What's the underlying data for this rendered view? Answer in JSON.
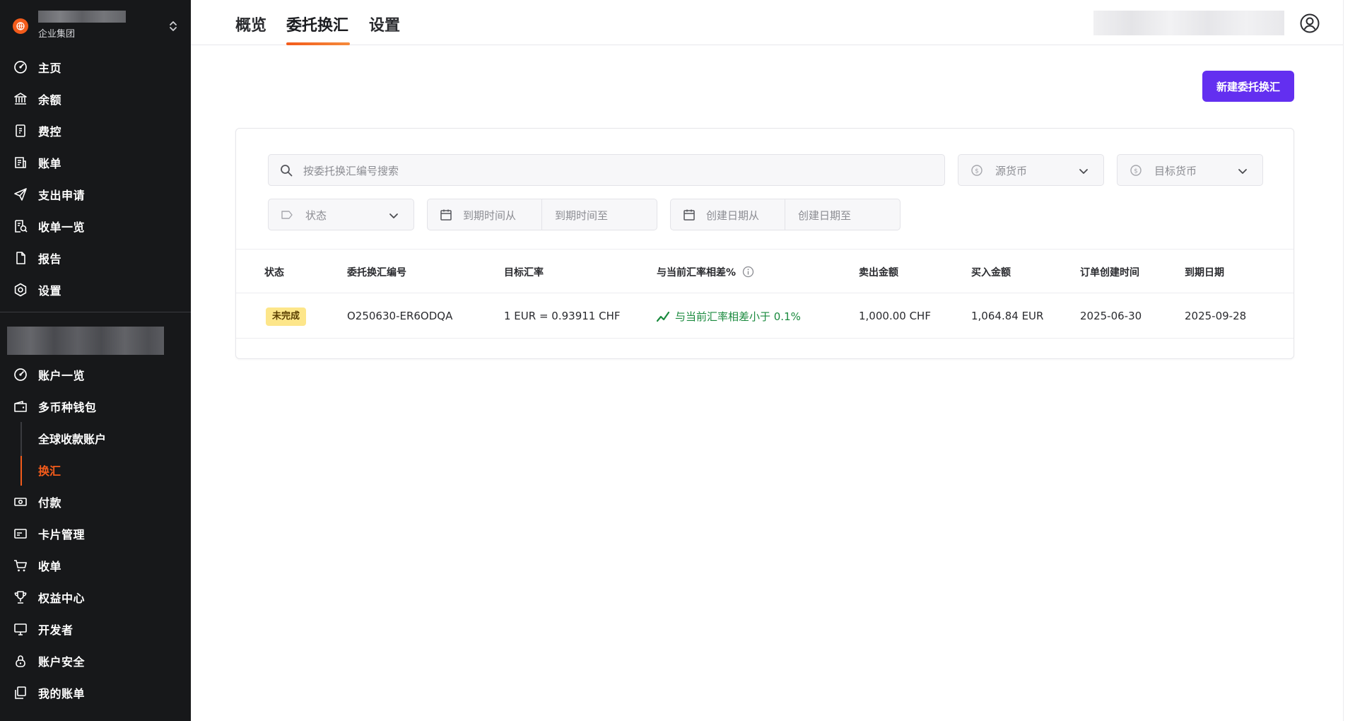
{
  "sidebar": {
    "org_subtitle": "企业集团",
    "items": [
      {
        "label": "主页",
        "icon": "dashboard-icon"
      },
      {
        "label": "余额",
        "icon": "bank-icon"
      },
      {
        "label": "费控",
        "icon": "receipt-icon"
      },
      {
        "label": "账单",
        "icon": "bill-icon"
      },
      {
        "label": "支出申请",
        "icon": "send-icon"
      },
      {
        "label": "收单一览",
        "icon": "search-doc-icon"
      },
      {
        "label": "报告",
        "icon": "file-icon"
      },
      {
        "label": "设置",
        "icon": "gear-icon"
      }
    ],
    "account_items": [
      {
        "label": "账户一览",
        "icon": "dashboard-icon"
      },
      {
        "label": "多币种钱包",
        "icon": "wallet-icon"
      }
    ],
    "wallet_sub": [
      {
        "label": "全球收款账户",
        "active": false
      },
      {
        "label": "换汇",
        "active": true
      }
    ],
    "more_items": [
      {
        "label": "付款",
        "icon": "cash-icon"
      },
      {
        "label": "卡片管理",
        "icon": "card-icon"
      },
      {
        "label": "收单",
        "icon": "cart-icon"
      },
      {
        "label": "权益中心",
        "icon": "trophy-icon"
      },
      {
        "label": "开发者",
        "icon": "monitor-icon"
      },
      {
        "label": "账户安全",
        "icon": "lock-icon"
      },
      {
        "label": "我的账单",
        "icon": "copy-icon"
      }
    ]
  },
  "tabs": [
    {
      "label": "概览",
      "active": false
    },
    {
      "label": "委托换汇",
      "active": true
    },
    {
      "label": "设置",
      "active": false
    }
  ],
  "new_button_label": "新建委托换汇",
  "filters": {
    "search_placeholder": "按委托换汇编号搜索",
    "source_currency": "源货币",
    "target_currency": "目标货币",
    "status": "状态",
    "expiry_from": "到期时间从",
    "expiry_to": "到期时间至",
    "created_from": "创建日期从",
    "created_to": "创建日期至"
  },
  "table": {
    "columns": [
      "状态",
      "委托换汇编号",
      "目标汇率",
      "与当前汇率相差%",
      "卖出金额",
      "买入金额",
      "订单创建时间",
      "到期日期"
    ],
    "rows": [
      {
        "status": "未完成",
        "order_id": "O250630-ER6ODQA",
        "target_rate": "1 EUR = 0.93911 CHF",
        "diff": "与当前汇率相差小于 0.1%",
        "sell_amount": "1,000.00 CHF",
        "buy_amount": "1,064.84 EUR",
        "created": "2025-06-30",
        "expiry": "2025-09-28"
      }
    ]
  },
  "colors": {
    "sidebar_bg": "#17181a",
    "accent_orange": "#f35b1b",
    "primary_purple": "#632ff0",
    "status_pending_bg": "#fde68a",
    "positive_green": "#1a8a3e"
  }
}
